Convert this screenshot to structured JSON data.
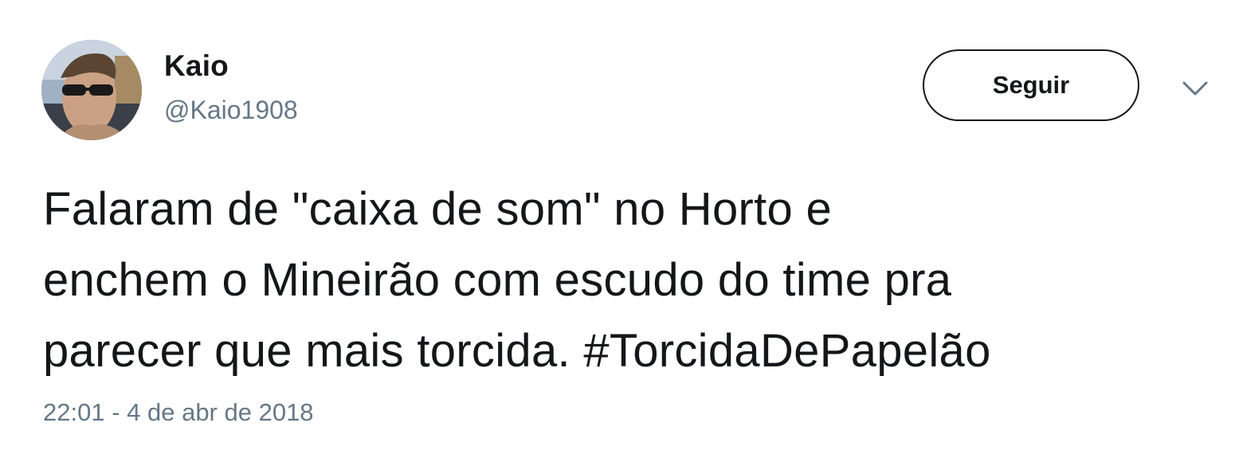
{
  "tweet": {
    "author": {
      "name": "Kaio",
      "handle": "@Kaio1908",
      "avatar_icon": "profile-photo"
    },
    "follow_button_label": "Seguir",
    "menu_icon": "chevron-down-icon",
    "text_lines": [
      "Falaram de \"caixa de som\" no Horto e",
      "enchem o Mineirão com escudo do time pra",
      "parecer que mais torcida. #TorcidaDePapelão"
    ],
    "timestamp": "22:01 - 4 de abr de 2018"
  },
  "colors": {
    "text_primary": "#14171a",
    "text_secondary": "#657786",
    "background": "#ffffff"
  }
}
